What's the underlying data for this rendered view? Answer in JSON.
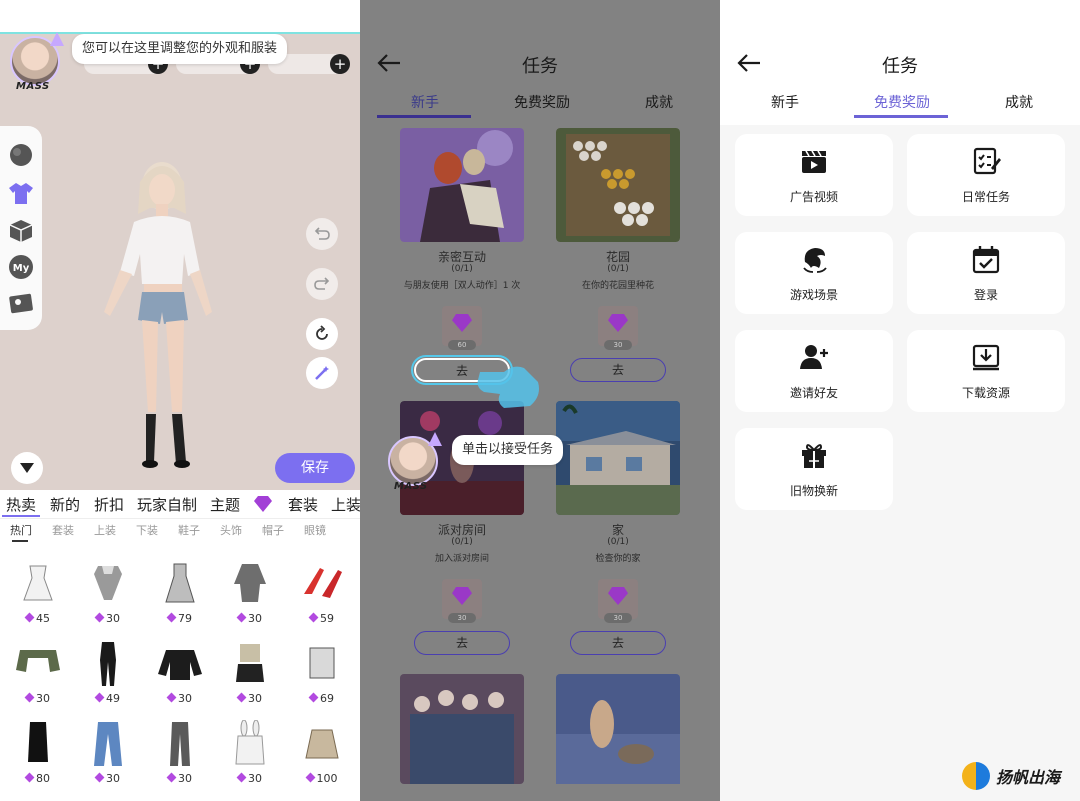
{
  "editor": {
    "tooltip": "您可以在这里调整您的外观和服装",
    "avatar_tag": "MASS",
    "save_label": "保存",
    "categories": [
      "热卖",
      "新的",
      "折扣",
      "玩家自制",
      "主题",
      "套装",
      "上装"
    ],
    "subcategories": [
      "热门",
      "套装",
      "上装",
      "下装",
      "鞋子",
      "头饰",
      "帽子",
      "眼镜"
    ],
    "item_prices": [
      "45",
      "30",
      "79",
      "30",
      "59",
      "30",
      "49",
      "30",
      "30",
      "69",
      "80",
      "30",
      "30",
      "30",
      "100"
    ],
    "icons": [
      "avatar-head-icon",
      "shirt-icon",
      "cube-icon",
      "my-icon",
      "photo-icon",
      "undo-icon",
      "redo-icon",
      "rotate-icon",
      "magic-wand-icon",
      "chevron-down-icon",
      "gem-icon"
    ],
    "colors": {
      "accent": "#7c6ff0",
      "stage": "#ddd1cc"
    }
  },
  "tasks_newbie": {
    "title": "任务",
    "tabs": [
      "新手",
      "免费奖励",
      "成就"
    ],
    "active_tab": 0,
    "tip": "单击以接受任务",
    "avatar_tag": "MASS",
    "go_label": "去",
    "cards": [
      {
        "name": "亲密互动",
        "progress": "(0/1)",
        "desc": "与朋友使用［双人动作］1 次",
        "reward": "60"
      },
      {
        "name": "花园",
        "progress": "(0/1)",
        "desc": "在你的花园里种花",
        "reward": "30"
      },
      {
        "name": "派对房间",
        "progress": "(0/1)",
        "desc": "加入派对房间",
        "reward": "30"
      },
      {
        "name": "家",
        "progress": "(0/1)",
        "desc": "检查你的家",
        "reward": "30"
      }
    ]
  },
  "tasks_rewards": {
    "title": "任务",
    "tabs": [
      "新手",
      "免费奖励",
      "成就"
    ],
    "active_tab": 1,
    "items": [
      {
        "label": "广告视频",
        "icon": "clapperboard-icon"
      },
      {
        "label": "日常任务",
        "icon": "checklist-icon"
      },
      {
        "label": "游戏场景",
        "icon": "dolphin-icon"
      },
      {
        "label": "登录",
        "icon": "calendar-check-icon"
      },
      {
        "label": "邀请好友",
        "icon": "add-user-icon"
      },
      {
        "label": "下载资源",
        "icon": "download-icon"
      },
      {
        "label": "旧物换新",
        "icon": "gift-icon"
      }
    ],
    "colors": {
      "accent": "#6c63d6"
    }
  },
  "watermark": {
    "text": "扬帆出海"
  }
}
